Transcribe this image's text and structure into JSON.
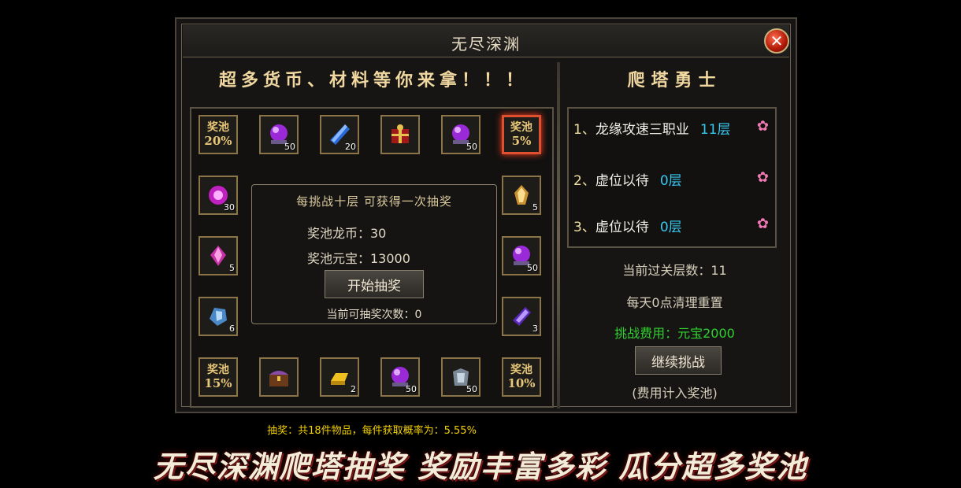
{
  "window": {
    "title": "无尽深渊"
  },
  "left": {
    "slogan": "超多货币、材料等你来拿！！！",
    "pools": {
      "p20": {
        "l1": "奖池",
        "l2": "20%"
      },
      "p5": {
        "l1": "奖池",
        "l2": "5%"
      },
      "p15": {
        "l1": "奖池",
        "l2": "15%"
      },
      "p10": {
        "l1": "奖池",
        "l2": "10%"
      }
    },
    "counts": {
      "top_orb1": "50",
      "top_crystal": "20",
      "top_orb2": "50",
      "left_burst": "30",
      "left_pinkgem": "5",
      "left_bluegem": "6",
      "right_goldgem": "5",
      "right_orb": "50",
      "right_purplegem": "3",
      "bot_gold": "2",
      "bot_orb": "50",
      "bot_armor": "50"
    },
    "center": {
      "title": "每挑战十层 可获得一次抽奖",
      "coin_line": "奖池龙币：30",
      "yuanbao_line": "奖池元宝：13000",
      "draw_button": "开始抽奖",
      "draw_count": "当前可抽奖次数：0"
    },
    "note": "抽奖：共18件物品，每件获取概率为：5.55%"
  },
  "right": {
    "title": "爬塔勇士",
    "ranks": [
      {
        "num": "1、",
        "name": "龙缘攻速三职业",
        "level": "11层"
      },
      {
        "num": "2、",
        "name": "虚位以待",
        "level": "0层"
      },
      {
        "num": "3、",
        "name": "虚位以待",
        "level": "0层"
      }
    ],
    "floors": "当前过关层数：11",
    "reset": "每天0点清理重置",
    "fee": "挑战费用：元宝2000",
    "continue_button": "继续挑战",
    "fee_note": "(费用计入奖池)"
  },
  "banner": "无尽深渊爬塔抽奖 奖励丰富多彩 瓜分超多奖池",
  "colors": {
    "gold": "#e8c878",
    "highlight": "#e05030",
    "fee": "#30d030",
    "level": "#38c8f0",
    "note": "#f2d000"
  }
}
